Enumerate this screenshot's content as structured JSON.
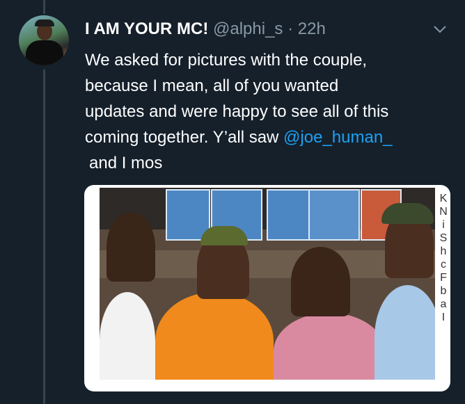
{
  "tweet": {
    "author_name": "I AM YOUR MC!",
    "handle": "@alphi_s",
    "separator": "·",
    "time": "22h",
    "text_lines": [
      "We asked for pictures with the couple,",
      "because I mean, all of you wanted",
      "updates and were happy to see all of this",
      "coming together. Y’all saw "
    ],
    "mention": "@joe_human_",
    "last_line": "and I mos"
  },
  "media": {
    "side_text_chars": [
      "K",
      "N",
      "i",
      "S",
      "h",
      "c",
      "F",
      "b",
      "a",
      "I"
    ]
  },
  "icons": {
    "avatar": "avatar-photo",
    "menu": "chevron-down-icon"
  },
  "colors": {
    "background": "#15202b",
    "secondary_text": "#8899a6",
    "link": "#1da1f2"
  }
}
